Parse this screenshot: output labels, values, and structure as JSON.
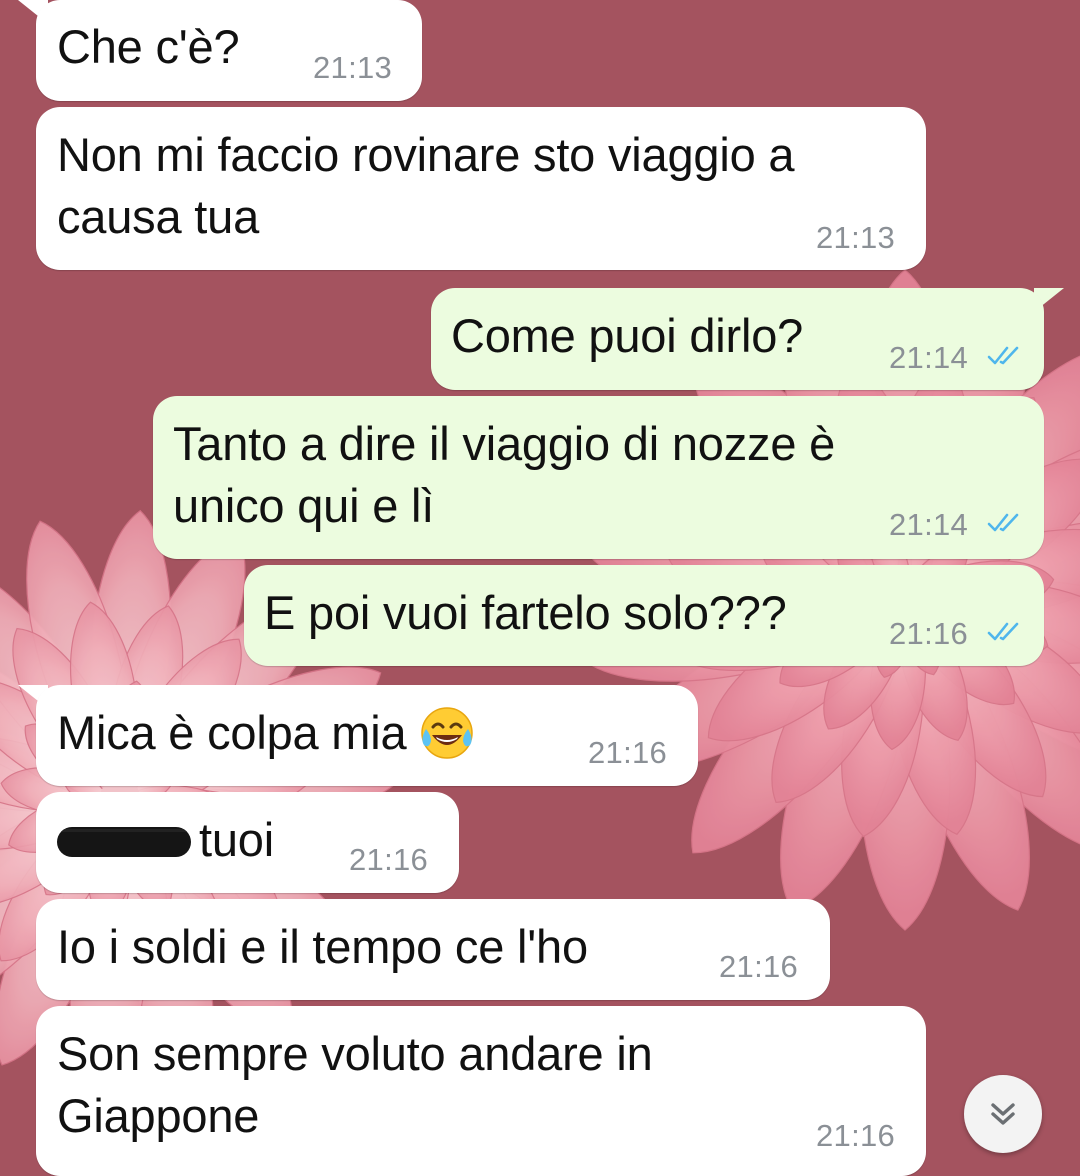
{
  "colors": {
    "background": "#a4535f",
    "incoming_bubble": "#ffffff",
    "outgoing_bubble": "#ecfcdf",
    "timestamp": "#8b9096",
    "read_ticks": "#4fb6ec"
  },
  "messages": [
    {
      "direction": "incoming",
      "text": "Che c'è?",
      "time": "21:13"
    },
    {
      "direction": "incoming",
      "text": "Non mi faccio rovinare sto viaggio a\ncausa tua",
      "time": "21:13"
    },
    {
      "direction": "outgoing",
      "text": "Come puoi dirlo?",
      "time": "21:14",
      "status_icon": "double-check-read-icon"
    },
    {
      "direction": "outgoing",
      "text": "Tanto a dire il viaggio di nozze è\nunico qui e lì",
      "time": "21:14",
      "status_icon": "double-check-read-icon"
    },
    {
      "direction": "outgoing",
      "text": "E poi vuoi fartelo solo???",
      "time": "21:16",
      "status_icon": "double-check-read-icon"
    },
    {
      "direction": "incoming",
      "text": "Mica è colpa mia",
      "time": "21:16",
      "emoji": "face-with-tears-of-joy-icon"
    },
    {
      "direction": "incoming",
      "text": "Cazzi tuoi",
      "visible_text": "tuoi",
      "time": "21:16",
      "redacted": true
    },
    {
      "direction": "incoming",
      "text": "Io i soldi e il tempo ce l'ho",
      "time": "21:16"
    },
    {
      "direction": "incoming",
      "text": "Son sempre voluto andare in\nGiappone",
      "time": "21:16"
    }
  ],
  "scroll_button": {
    "icon": "double-chevron-down-icon"
  }
}
